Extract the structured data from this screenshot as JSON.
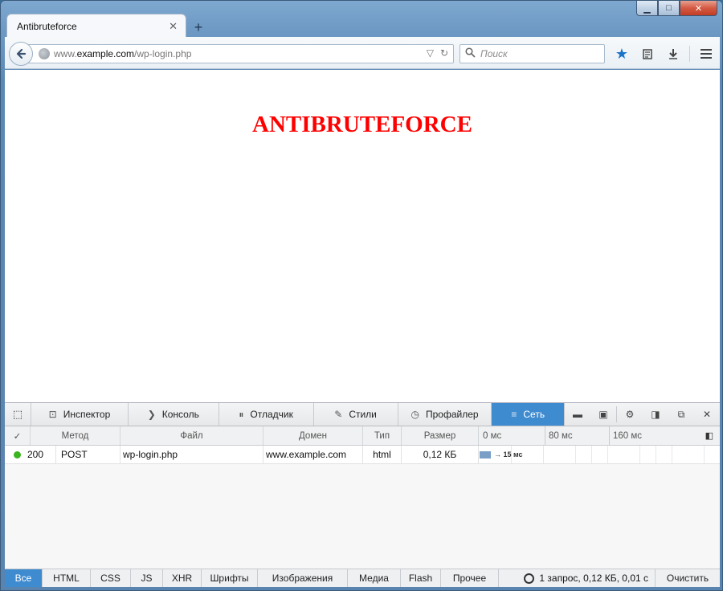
{
  "window": {
    "controls": {
      "minimize": "▁",
      "maximize": "□",
      "close": "✕"
    }
  },
  "tab": {
    "title": "Antibruteforce",
    "close": "✕",
    "new_tab": "+"
  },
  "navbar": {
    "url_prefix": "www.",
    "url_host": "example.com",
    "url_path": "/wp-login.php",
    "search_placeholder": "Поиск"
  },
  "page": {
    "heading": "ANTIBRUTEFORCE",
    "heading_color": "#ff0000"
  },
  "devtools": {
    "tabs": [
      {
        "label": "Инспектор",
        "icon": "inspector-icon"
      },
      {
        "label": "Консоль",
        "icon": "console-icon"
      },
      {
        "label": "Отладчик",
        "icon": "debugger-icon"
      },
      {
        "label": "Стили",
        "icon": "styles-icon"
      },
      {
        "label": "Профайлер",
        "icon": "profiler-icon"
      },
      {
        "label": "Сеть",
        "icon": "network-icon",
        "active": true
      }
    ],
    "accent": "#3f8bd0",
    "network": {
      "columns": [
        "✓",
        "Метод",
        "Файл",
        "Домен",
        "Тип",
        "Размер",
        "0 мс",
        "80 мс",
        "160 мс"
      ],
      "rows": [
        {
          "status": "200",
          "method": "POST",
          "file": "wp-login.php",
          "domain": "www.example.com",
          "type": "html",
          "size": "0,12 КБ",
          "timing": "→ 15 мс"
        }
      ]
    },
    "filters": [
      "Все",
      "HTML",
      "CSS",
      "JS",
      "XHR",
      "Шрифты",
      "Изображения",
      "Медиа",
      "Flash",
      "Прочее"
    ],
    "summary": "1 запрос, 0,12 КБ, 0,01 с",
    "clear_label": "Очистить"
  }
}
